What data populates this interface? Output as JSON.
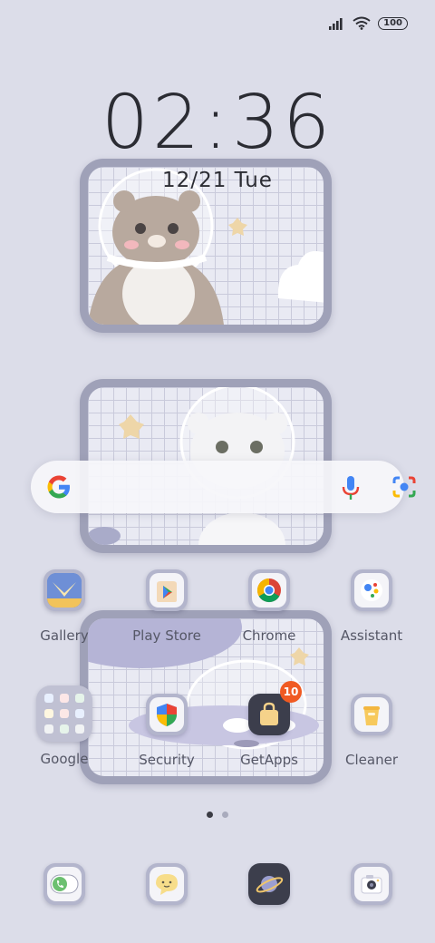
{
  "status": {
    "battery": "100",
    "signal_icon": "signal-icon",
    "wifi_icon": "wifi-icon"
  },
  "clock": {
    "time": "02:36",
    "date": "12/21 Tue"
  },
  "search": {
    "google_icon": "google-g-icon",
    "mic_icon": "mic-icon",
    "lens_icon": "lens-camera-icon"
  },
  "apps_row1": [
    {
      "label": "Gallery",
      "icon": "gallery-icon"
    },
    {
      "label": "Play Store",
      "icon": "play-store-icon"
    },
    {
      "label": "Chrome",
      "icon": "chrome-icon"
    },
    {
      "label": "Assistant",
      "icon": "assistant-icon"
    }
  ],
  "apps_row2": [
    {
      "label": "Google",
      "icon": "folder-icon"
    },
    {
      "label": "Security",
      "icon": "shield-icon"
    },
    {
      "label": "GetApps",
      "icon": "shopping-bag-icon",
      "badge": "10"
    },
    {
      "label": "Cleaner",
      "icon": "trash-icon"
    }
  ],
  "page_indicator": {
    "pages": 2,
    "current": 1
  },
  "dock": [
    {
      "icon": "phone-icon"
    },
    {
      "icon": "messages-icon"
    },
    {
      "icon": "planet-browser-icon"
    },
    {
      "icon": "camera-icon"
    }
  ],
  "colors": {
    "background": "#dcdde9",
    "badge": "#f05a22",
    "frame": "#9fa1b8"
  }
}
